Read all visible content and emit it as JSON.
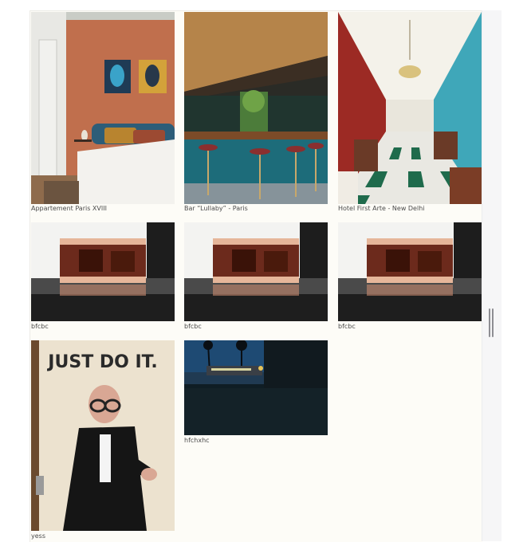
{
  "gallery": {
    "items": [
      {
        "caption": "Appartement Paris XVIII",
        "image": "bedroom-photo"
      },
      {
        "caption": "Bar “Lullaby” - Paris",
        "image": "bar-photo"
      },
      {
        "caption": "Hotel First Arte - New Delhi",
        "image": "restaurant-photo"
      },
      {
        "caption": "bfcbc",
        "image": "film-strip-photo"
      },
      {
        "caption": "bfcbc",
        "image": "film-strip-photo"
      },
      {
        "caption": "bfcbc",
        "image": "film-strip-photo"
      },
      {
        "caption": "yess",
        "image": "poster-photo",
        "poster_text": "JUST DO IT."
      },
      {
        "caption": "hfchxhc",
        "image": "night-street-photo"
      }
    ]
  },
  "colors": {
    "canvas": "#fdfcf7",
    "rail": "#f6f6f7",
    "caption_text": "#4b4b4b"
  }
}
